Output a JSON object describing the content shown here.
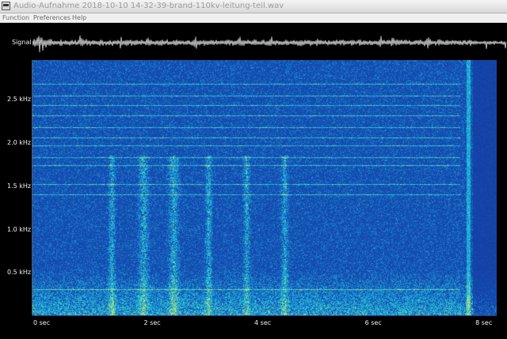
{
  "window": {
    "title": "Audio-Aufnahme 2018-10-10 14-32-39-brand-110kv-leitung-teil.wav"
  },
  "menu": {
    "function": "Function",
    "preferences": "Preferences",
    "help": "Help"
  },
  "signal_label": "Signal",
  "y_axis": {
    "labels": [
      "2.5 kHz",
      "2.0 kHz",
      "1.5 kHz",
      "1.0 kHz",
      "0.5 kHz"
    ],
    "values_khz": [
      2.5,
      2.0,
      1.5,
      1.0,
      0.5
    ],
    "range_khz": [
      0,
      2.95
    ]
  },
  "x_axis": {
    "labels": [
      "0 sec",
      "2 sec",
      "4 sec",
      "6 sec",
      "8 sec"
    ],
    "values_sec": [
      0,
      2,
      4,
      6,
      8
    ],
    "range_sec": [
      0,
      8.4
    ]
  },
  "colors": {
    "background": "#000000",
    "spectrogram_base": "#1f55b0",
    "spectrogram_highlight": "#35c9e8",
    "spectrogram_hot": "#e6e85a",
    "waveform": "#f2f2f2"
  }
}
